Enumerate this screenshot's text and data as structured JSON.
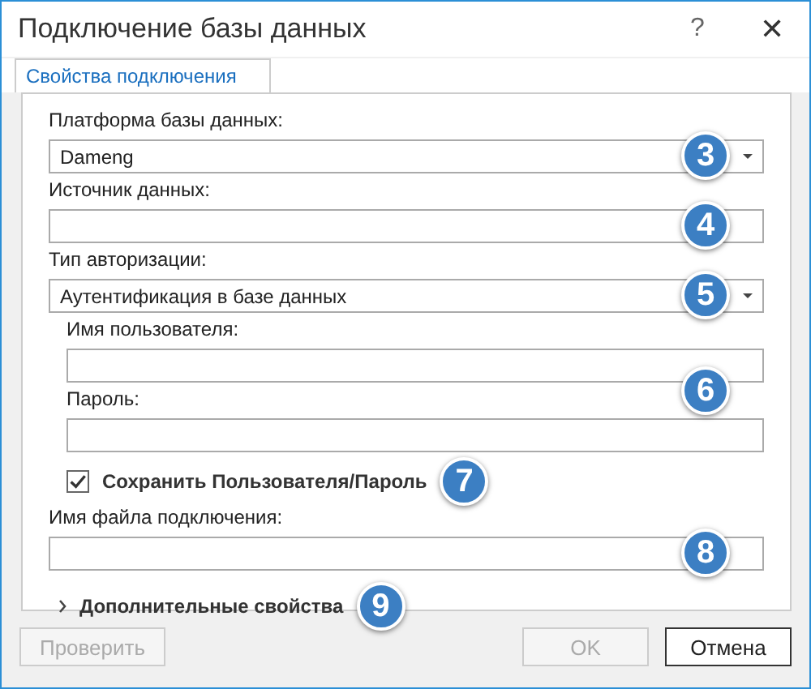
{
  "window": {
    "title": "Подключение базы данных",
    "help": "?",
    "close": "✕"
  },
  "tabs": [
    {
      "label": "Свойства подключения",
      "selected": true
    }
  ],
  "fields": [
    {
      "kind": "dropdown",
      "label": "Платформа базы данных:",
      "value": "Dameng",
      "indent": false,
      "callout": "3"
    },
    {
      "kind": "text",
      "label": "Источник данных:",
      "indent": false,
      "callout": "4"
    },
    {
      "kind": "dropdown",
      "label": "Тип авторизации:",
      "value": "Аутентификация в базе данных",
      "indent": false,
      "callout": "5"
    },
    {
      "kind": "text",
      "label": "Имя пользователя:",
      "indent": true,
      "callout": "6"
    },
    {
      "kind": "text",
      "label": "Пароль:",
      "indent": true
    },
    {
      "kind": "checkbox",
      "label": "Сохранить Пользователя/Пароль",
      "checked": true,
      "indent": true,
      "callout": "7"
    },
    {
      "kind": "text",
      "label": "Имя файла подключения:",
      "indent": false,
      "callout": "8"
    },
    {
      "kind": "expander",
      "label": "Дополнительные свойства",
      "expanded": false,
      "indent": false,
      "callout": "9"
    }
  ],
  "buttons": [
    {
      "label": "Проверить",
      "disabled": true
    },
    {
      "label": "OK",
      "disabled": true
    },
    {
      "label": "Отмена",
      "disabled": false
    }
  ]
}
